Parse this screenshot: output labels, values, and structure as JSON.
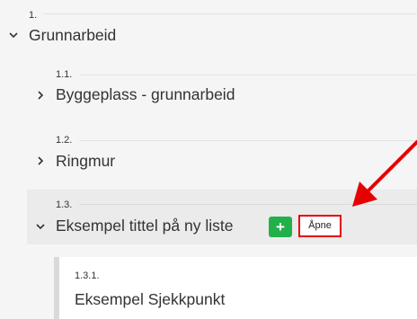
{
  "sections": [
    {
      "number": "1.",
      "title": "Grunnarbeid",
      "state": "expanded"
    },
    {
      "number": "1.1.",
      "title": "Byggeplass - grunnarbeid",
      "state": "collapsed"
    },
    {
      "number": "1.2.",
      "title": "Ringmur",
      "state": "collapsed"
    },
    {
      "number": "1.3.",
      "title": "Eksempel tittel på ny liste",
      "state": "expanded"
    }
  ],
  "actions": {
    "add_label": "+",
    "open_label": "Åpne"
  },
  "child": {
    "number": "1.3.1.",
    "title": "Eksempel Sjekkpunkt"
  },
  "colors": {
    "add_button": "#22b04b",
    "highlight": "#e60000",
    "background": "#f5f5f5"
  }
}
